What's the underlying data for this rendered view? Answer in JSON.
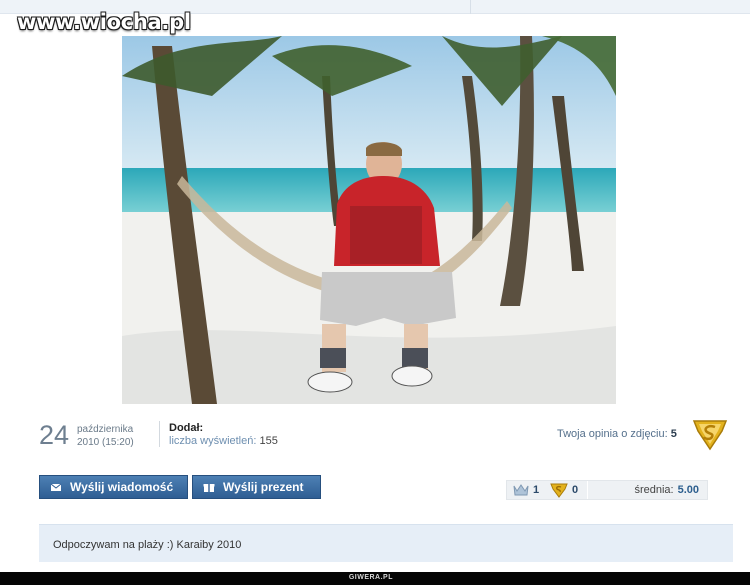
{
  "watermark": "www.wiocha.pl",
  "photo": {
    "subject": "beach-hammock-photo"
  },
  "date": {
    "day": "24",
    "month": "października",
    "time": "2010 (15:20)"
  },
  "author": {
    "label": "Dodał:"
  },
  "views": {
    "label": "liczba wyświetleń:",
    "count": "155"
  },
  "opinion": {
    "label": "Twoja opinia o zdjęciu:",
    "value": "5"
  },
  "buttons": {
    "message": "Wyślij wiadomość",
    "gift": "Wyślij prezent"
  },
  "rating": {
    "crown_count": "1",
    "super_count": "0",
    "avg_label": "średnia:",
    "avg_value": "5.00"
  },
  "description": "Odpoczywam na plaży :) Karaiby 2010",
  "footer": "GIWERA.PL",
  "colors": {
    "button": "#2f5e93",
    "desc_bg": "#e6eef7",
    "badge_gold": "#e3b21d"
  },
  "icons": [
    "envelope-icon",
    "gift-icon",
    "crown-icon",
    "super-badge-icon"
  ]
}
